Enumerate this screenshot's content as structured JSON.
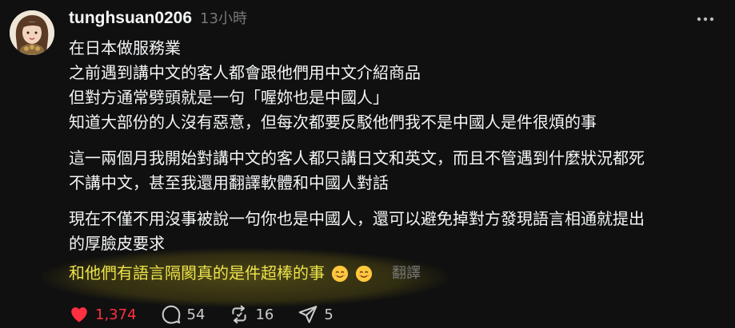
{
  "post": {
    "username": "tunghsuan0206",
    "timestamp": "13小時",
    "more_icon": "more-horizontal-icon",
    "paragraphs": [
      [
        "在日本做服務業",
        "之前遇到講中文的客人都會跟他們用中文介紹商品",
        "但對方通常劈頭就是一句「喔妳也是中國人」",
        "知道大部份的人沒有惡意，但每次都要反駁他們我不是中國人是件很煩的事"
      ],
      [
        "這一兩個月我開始對講中文的客人都只講日文和英文，而且不管遇到什麼狀況都死",
        "不講中文，甚至我還用翻譯軟體和中國人對話"
      ],
      [
        "現在不僅不用沒事被說一句你也是中國人，還可以避免掉對方發現語言相通就提出",
        "的厚臉皮要求"
      ]
    ],
    "highlighted_line": "和他們有語言隔閡真的是件超棒的事",
    "emojis": [
      "smiling-face-icon",
      "smiling-face-icon"
    ],
    "translate_label": "翻譯"
  },
  "actions": {
    "likes": "1,374",
    "comments": "54",
    "reposts": "16",
    "shares": "5"
  },
  "colors": {
    "background": "#101010",
    "text": "#f3f5f7",
    "muted": "#777777",
    "like": "#ff3040",
    "highlight_text": "#ece24a"
  }
}
